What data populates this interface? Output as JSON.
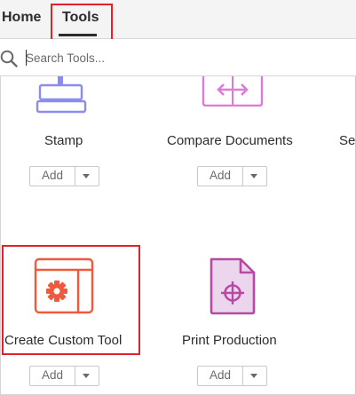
{
  "nav": {
    "tabs": [
      {
        "label": "Home"
      },
      {
        "label": "Tools",
        "active": true
      }
    ]
  },
  "search": {
    "placeholder": "Search Tools..."
  },
  "tools": [
    {
      "name": "Stamp",
      "icon": "stamp-icon",
      "add_label": "Add",
      "color": "#8c8cf0"
    },
    {
      "name": "Compare Documents",
      "icon": "compare-documents-icon",
      "add_label": "Add",
      "color": "#e07ad9"
    },
    {
      "name": "Se",
      "icon": "",
      "add_label": "",
      "color": ""
    },
    {
      "name": "Create Custom Tool",
      "icon": "create-custom-tool-icon",
      "add_label": "Add",
      "color": "#f05a3c"
    },
    {
      "name": "Print Production",
      "icon": "print-production-icon",
      "add_label": "Add",
      "color": "#b84aa5"
    }
  ],
  "colors": {
    "highlight": "#e0222b"
  }
}
